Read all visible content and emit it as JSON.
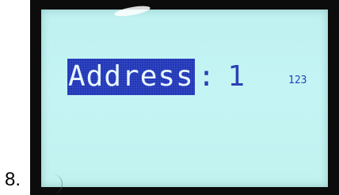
{
  "step": {
    "number": "8."
  },
  "lcd": {
    "field_label": "Address",
    "separator": ":",
    "field_value": "1",
    "input_mode": "123"
  },
  "colors": {
    "screen_background": "#c2f3f2",
    "text": "#2c40b6",
    "highlight": "#2036b8",
    "highlight_text": "#e8f6ff",
    "frame": "#0b0c0b"
  }
}
